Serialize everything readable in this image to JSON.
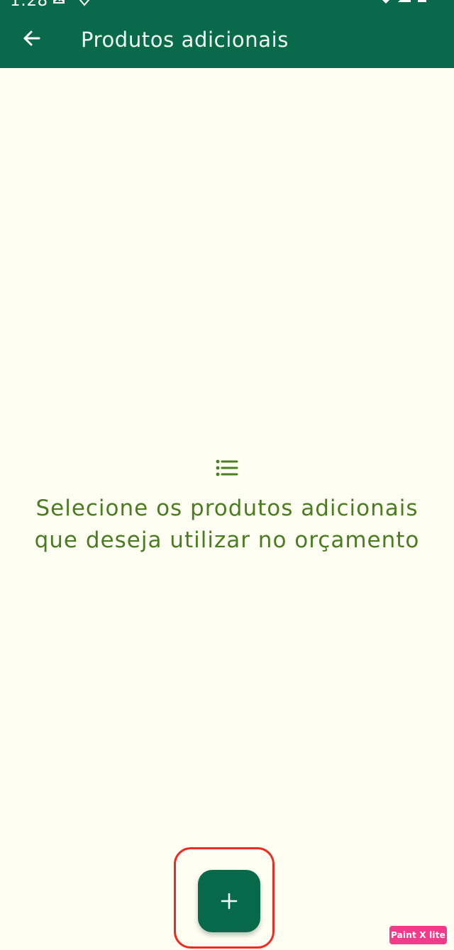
{
  "status_bar": {
    "time": "1:28",
    "icons": [
      "image-icon",
      "location-icon",
      "wifi-icon",
      "signal-icon",
      "battery-icon"
    ]
  },
  "appbar": {
    "back_icon": "arrow-left-icon",
    "title": "Produtos adicionais",
    "background_color": "#086a4a"
  },
  "empty_state": {
    "icon": "list-icon",
    "line_1": "Selecione os produtos adicionais",
    "line_2": "que deseja utilizar no orçamento",
    "text_color": "#4a7c21"
  },
  "fab": {
    "icon": "plus-icon",
    "background_color": "#066a4a",
    "highlight_color": "#ef2a20"
  },
  "watermark": {
    "text": "Paint X lite",
    "background_color": "#f43a8a"
  }
}
